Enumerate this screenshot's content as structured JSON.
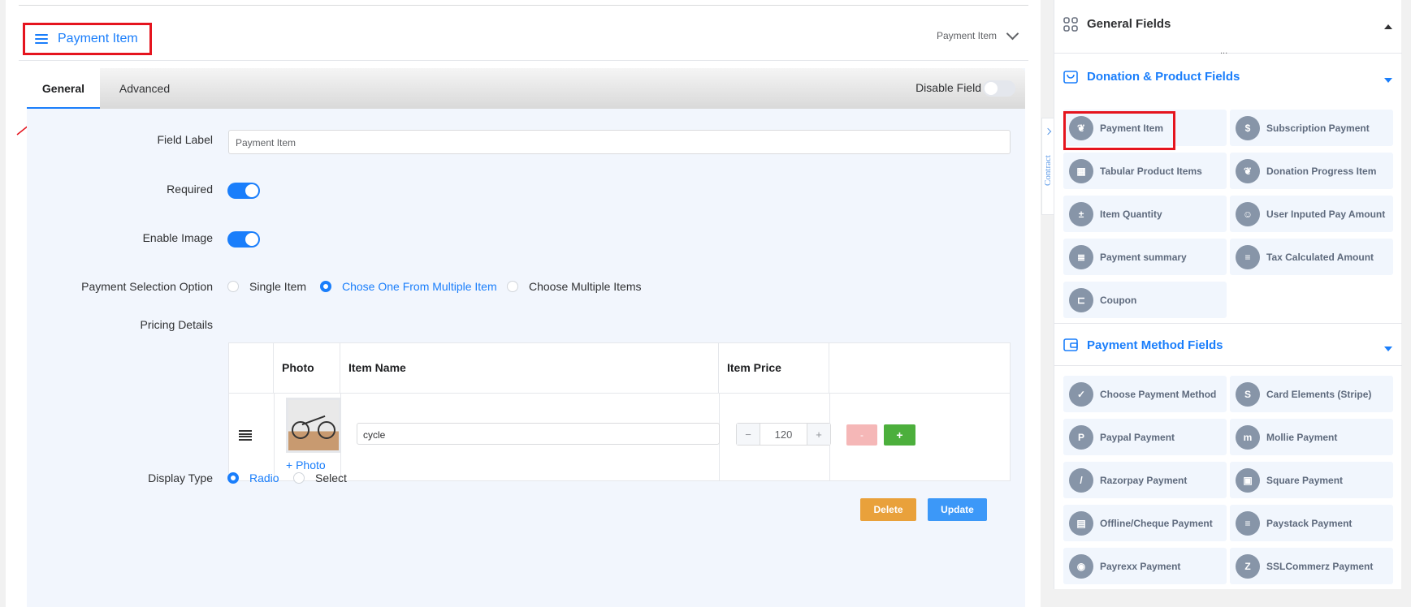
{
  "header": {
    "title": "Payment Item",
    "right_label": "Payment Item"
  },
  "tabs": {
    "general": "General",
    "advanced": "Advanced",
    "disable_field": "Disable Field"
  },
  "form": {
    "field_label": "Field Label",
    "field_label_value": "Payment Item",
    "required": "Required",
    "enable_image": "Enable Image",
    "payment_selection": "Payment Selection Option",
    "options": [
      "Single Item",
      "Chose One From Multiple Item",
      "Choose Multiple Items"
    ],
    "selected_option": "Chose One From Multiple Item",
    "pricing_details": "Pricing Details",
    "display_type": "Display Type",
    "display_options": [
      "Radio",
      "Select"
    ],
    "selected_display": "Radio"
  },
  "pricing_table": {
    "headers": [
      "Photo",
      "Item Name",
      "Item Price"
    ],
    "rows": [
      {
        "name": "cycle",
        "price": "120",
        "add_photo": "+ Photo",
        "minus": "-",
        "plus": "+"
      }
    ]
  },
  "stepper": {
    "dec": "−",
    "inc": "+"
  },
  "actions": {
    "delete": "Delete",
    "update": "Update"
  },
  "sidebar": {
    "contract": "Contract",
    "ellipsis": "...",
    "general_fields": "General Fields",
    "donation_section": "Donation & Product Fields",
    "donation_items": [
      "Payment Item",
      "Subscription Payment",
      "Tabular Product Items",
      "Donation Progress Item",
      "Item Quantity",
      "User Inputed Pay Amount",
      "Payment summary",
      "Tax Calculated Amount",
      "Coupon"
    ],
    "payment_method_section": "Payment Method Fields",
    "payment_items": [
      "Choose Payment Method",
      "Card Elements (Stripe)",
      "Paypal Payment",
      "Mollie Payment",
      "Razorpay Payment",
      "Square Payment",
      "Offline/Cheque Payment",
      "Paystack Payment",
      "Payrexx Payment",
      "SSLCommerz Payment"
    ]
  },
  "colors": {
    "accent": "#1a7efb",
    "highlight": "#e5141e",
    "delete": "#e9a13b",
    "add": "#4caf3c"
  }
}
